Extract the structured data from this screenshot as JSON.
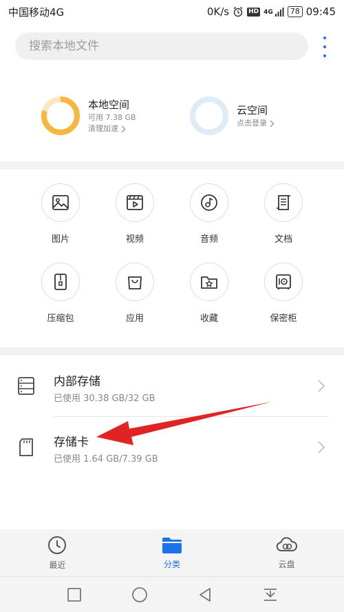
{
  "status_bar": {
    "carrier": "中国移动4G",
    "speed": "0K/s",
    "network": "4G",
    "battery": "78",
    "time": "09:45",
    "hd": "HD"
  },
  "search": {
    "placeholder": "搜索本地文件"
  },
  "storage": {
    "local": {
      "title": "本地空间",
      "available": "可用 7.38 GB",
      "action": "清理加速",
      "ring_color": "#f7b63d"
    },
    "cloud": {
      "title": "云空间",
      "action": "点击登录",
      "ring_color": "#deebf8"
    }
  },
  "categories": [
    {
      "label": "图片",
      "icon": "image-icon"
    },
    {
      "label": "视频",
      "icon": "video-icon"
    },
    {
      "label": "音频",
      "icon": "audio-icon"
    },
    {
      "label": "文档",
      "icon": "document-icon"
    },
    {
      "label": "压缩包",
      "icon": "archive-icon"
    },
    {
      "label": "应用",
      "icon": "app-bag-icon"
    },
    {
      "label": "收藏",
      "icon": "favorites-folder-icon"
    },
    {
      "label": "保密柜",
      "icon": "safe-icon"
    }
  ],
  "devices": [
    {
      "name": "内部存储",
      "usage": "已使用 30.38 GB/32 GB",
      "icon": "internal-storage-icon"
    },
    {
      "name": "存储卡",
      "usage": "已使用 1.64 GB/7.39 GB",
      "icon": "sd-card-icon"
    }
  ],
  "bottom_nav": [
    {
      "label": "最近",
      "icon": "clock-icon",
      "active": false
    },
    {
      "label": "分类",
      "icon": "folder-icon",
      "active": true
    },
    {
      "label": "云盘",
      "icon": "cloud-icon",
      "active": false
    }
  ],
  "colors": {
    "accent": "#1a73e8",
    "annotation_arrow": "#e02424"
  }
}
